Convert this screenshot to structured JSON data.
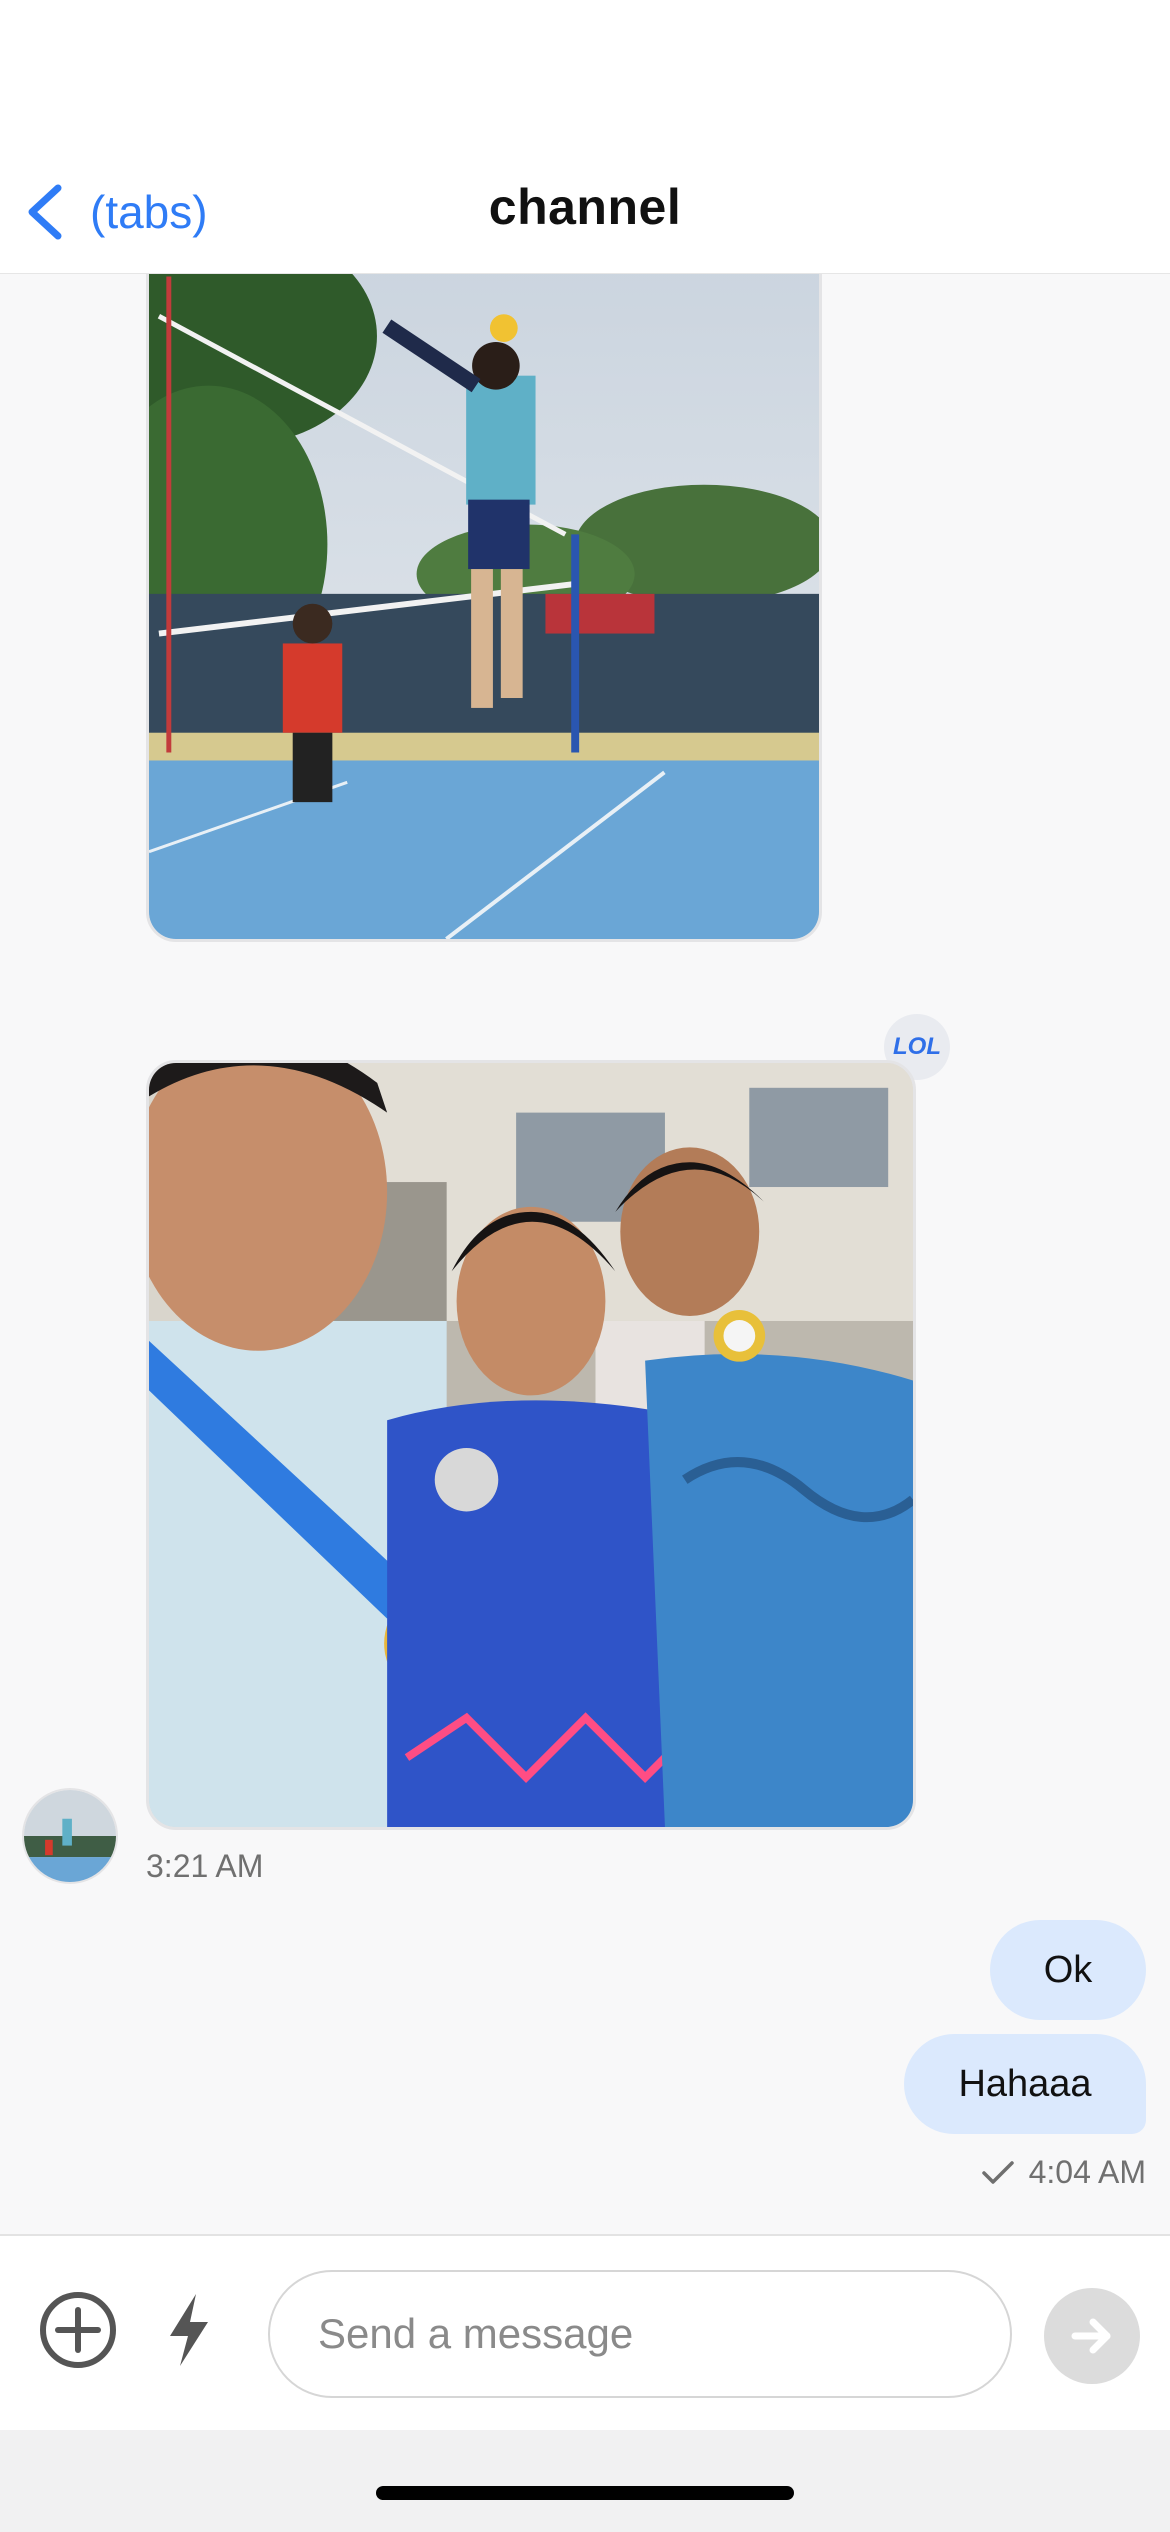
{
  "nav": {
    "back_label": "(tabs)",
    "title": "channel"
  },
  "messages": {
    "received": {
      "images": [
        {
          "name": "volleyball-spike-photo"
        },
        {
          "name": "medal-selfie-photo"
        }
      ],
      "reaction": "LOL",
      "time": "3:21 AM"
    },
    "sent": {
      "bubbles": [
        "Ok",
        "Hahaaa"
      ],
      "time": "4:04 AM",
      "status_icon": "checkmark-icon"
    }
  },
  "composer": {
    "placeholder": "Send a message",
    "value": ""
  },
  "colors": {
    "accent": "#2f7cf6",
    "sent_bubble": "#dbe9fd",
    "background": "#f8f8f9"
  }
}
